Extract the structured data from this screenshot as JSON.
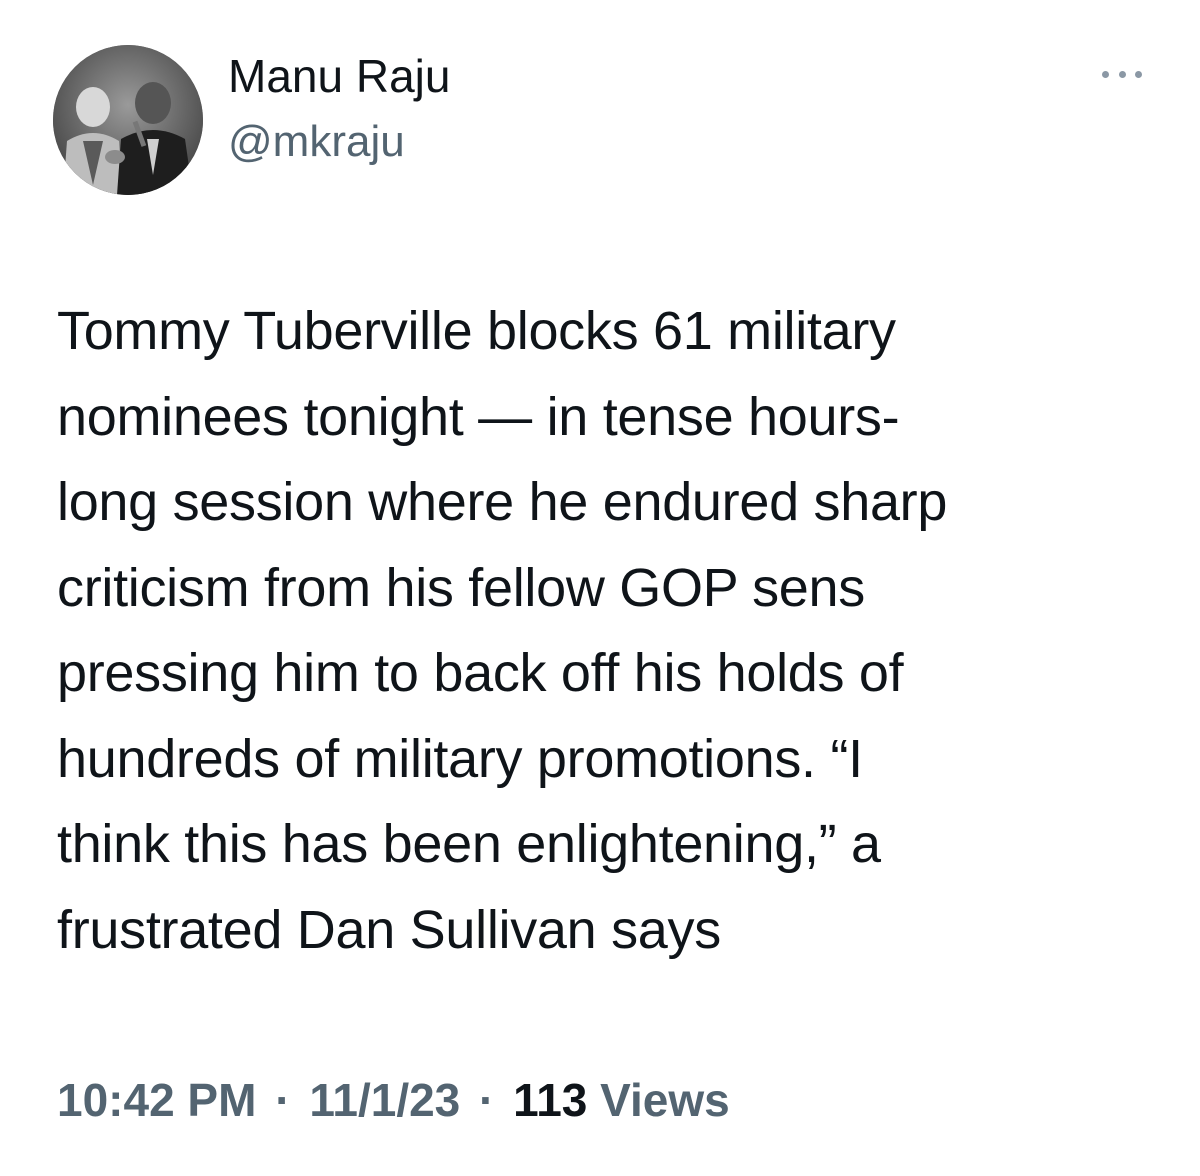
{
  "author": {
    "display_name": "Manu Raju",
    "handle": "@mkraju"
  },
  "tweet": {
    "text": "Tommy Tuberville blocks 61 military\nnominees tonight — in tense hours-\nlong session where he endured sharp\ncriticism from his fellow GOP sens\npressing him to back off his holds of\nhundreds of military promotions. “I\nthink this has been enlightening,” a\nfrustrated Dan Sullivan says"
  },
  "meta": {
    "time": "10:42 PM",
    "separator": "·",
    "date": "11/1/23",
    "views_count": "113",
    "views_label": "Views"
  },
  "icons": {
    "more": "more-horizontal-icon"
  },
  "colors": {
    "primary_text": "#0f1419",
    "secondary_text": "#536471",
    "background": "#ffffff"
  }
}
